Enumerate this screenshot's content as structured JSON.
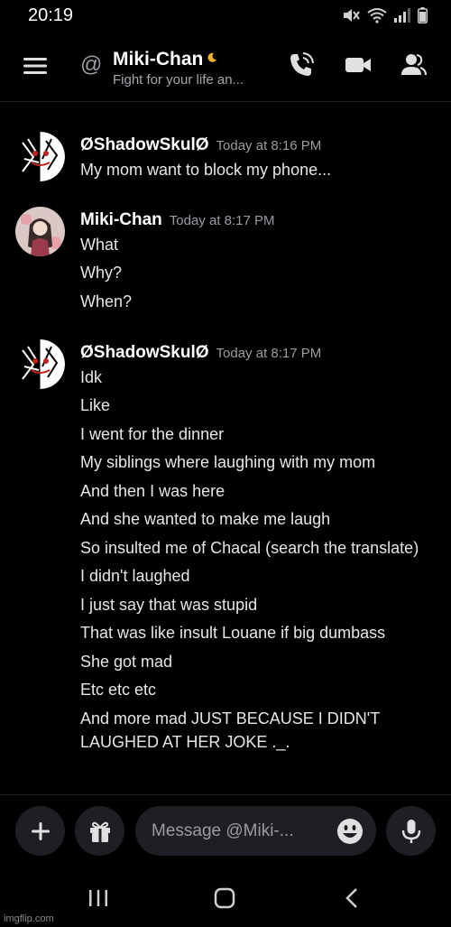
{
  "status_bar": {
    "time": "20:19"
  },
  "header": {
    "contact_name": "Miki-Chan",
    "contact_status": "Fight for your life an...",
    "at_symbol": "@"
  },
  "messages": [
    {
      "author": "ØShadowSkulØ",
      "timestamp": "Today at 8:16 PM",
      "lines": [
        "My mom want to block my phone..."
      ]
    },
    {
      "author": "Miki-Chan",
      "timestamp": "Today at 8:17 PM",
      "lines": [
        "What",
        "Why?",
        "When?"
      ]
    },
    {
      "author": "ØShadowSkulØ",
      "timestamp": "Today at 8:17 PM",
      "lines": [
        "Idk",
        "Like",
        "I went for the dinner",
        "My siblings where laughing with my mom",
        "And then I was here",
        "And she wanted to make me laugh",
        "So insulted me of Chacal (search the translate)",
        "I didn't laughed",
        "I just say that was stupid",
        "That was like insult Louane if big dumbass",
        "She got mad",
        "Etc etc etc",
        "And more mad JUST BECAUSE I DIDN'T",
        "LAUGHED AT HER JOKE ._."
      ]
    }
  ],
  "composer": {
    "placeholder": "Message @Miki-..."
  },
  "watermark": "imgflip.com",
  "icons": {
    "menu": "hamburger-icon",
    "call": "phone-call-icon",
    "video": "video-camera-icon",
    "members": "user-icon",
    "add": "plus-icon",
    "gift": "gift-icon",
    "emoji": "smiley-icon",
    "mic": "microphone-icon"
  },
  "colors": {
    "background": "#000000",
    "surface": "#1e1f24",
    "muted_text": "#9a9ca3",
    "status_moon": "#f0b232"
  }
}
